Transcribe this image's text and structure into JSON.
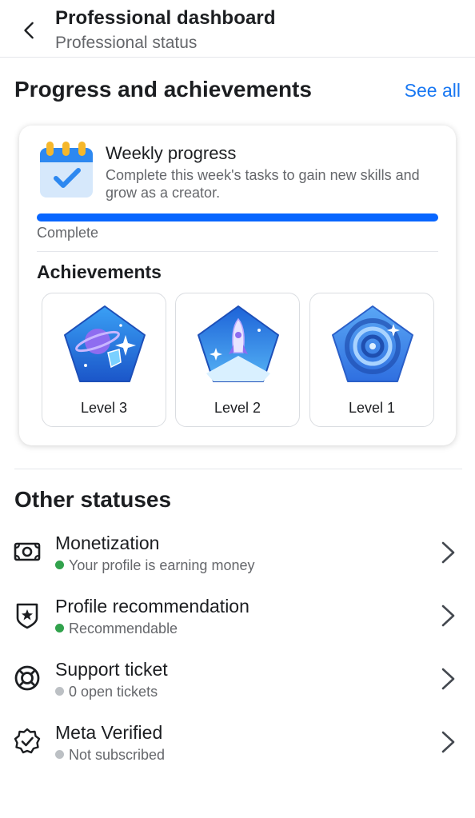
{
  "header": {
    "title": "Professional dashboard",
    "subtitle": "Professional status",
    "back_icon": "chevron-left-icon"
  },
  "progress_section": {
    "title": "Progress and achievements",
    "see_all": "See all",
    "weekly": {
      "icon": "calendar-check-icon",
      "title": "Weekly progress",
      "description": "Complete this week's tasks to gain new skills and grow as a creator.",
      "progress_percent": 100,
      "progress_label": "Complete"
    },
    "achievements": {
      "title": "Achievements",
      "badges": [
        {
          "label": "Level 3",
          "icon": "planet-badge-icon"
        },
        {
          "label": "Level 2",
          "icon": "rocket-badge-icon"
        },
        {
          "label": "Level 1",
          "icon": "spiral-badge-icon"
        }
      ]
    }
  },
  "other_statuses": {
    "title": "Other statuses",
    "items": [
      {
        "title": "Monetization",
        "subtitle": "Your profile is earning money",
        "status": "active",
        "icon": "money-icon"
      },
      {
        "title": "Profile recommendation",
        "subtitle": "Recommendable",
        "status": "active",
        "icon": "shield-star-icon"
      },
      {
        "title": "Support ticket",
        "subtitle": "0 open tickets",
        "status": "inactive",
        "icon": "lifebuoy-icon"
      },
      {
        "title": "Meta Verified",
        "subtitle": "Not subscribed",
        "status": "inactive",
        "icon": "verified-badge-icon"
      }
    ]
  },
  "colors": {
    "accent": "#0866ff",
    "link": "#1877f2",
    "status_active": "#31a24c",
    "status_inactive": "#bcc0c4"
  }
}
